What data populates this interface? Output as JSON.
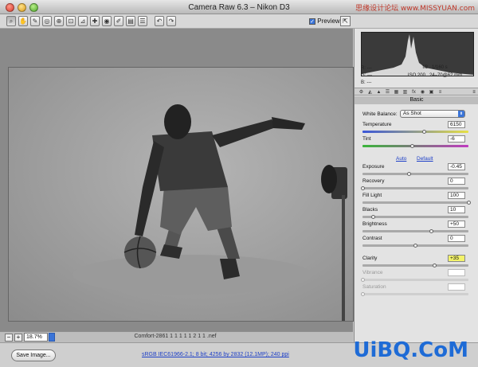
{
  "window": {
    "title": "Camera Raw 6.3  –  Nikon D3",
    "watermark_top": "思缘设计论坛  www.MISSYUAN.com"
  },
  "toolbar": {
    "tools": [
      "zoom-icon",
      "hand-icon",
      "white-balance-icon",
      "color-sampler-icon",
      "target-adjust-icon",
      "crop-icon",
      "straighten-icon",
      "spot-removal-icon",
      "red-eye-icon",
      "adjustment-brush-icon",
      "graduated-filter-icon",
      "preferences-icon",
      "rotate-ccw-icon",
      "rotate-cw-icon"
    ],
    "tool_glyphs": [
      "⌕",
      "✋",
      "✎",
      "◎",
      "⊕",
      "⊡",
      "⊿",
      "✚",
      "◉",
      "✐",
      "▤",
      "☰",
      "↶",
      "↷"
    ],
    "preview_label": "Preview",
    "preview_checked": true,
    "fullscreen_glyph": "⇱"
  },
  "histogram": {
    "r_label": "R:",
    "r_value": "---",
    "g_label": "G:",
    "g_value": "---",
    "b_label": "B:",
    "b_value": "---",
    "aperture": "f/8",
    "shutter": "1/160 s",
    "iso": "ISO 200",
    "lens": "24–70@62 mm"
  },
  "panel_tabs": [
    "⚙",
    "◭",
    "▲",
    "☰",
    "▦",
    "▥",
    "fx",
    "◉",
    "▣",
    "≡"
  ],
  "panel_menu_glyph": "≡",
  "basic": {
    "header": "Basic",
    "white_balance_label": "White Balance:",
    "white_balance_value": "As Shot",
    "temperature_label": "Temperature",
    "temperature_value": "6150",
    "temperature_pos": 0.58,
    "tint_label": "Tint",
    "tint_value": "-6",
    "tint_pos": 0.47,
    "auto_label": "Auto",
    "default_label": "Default",
    "exposure_label": "Exposure",
    "exposure_value": "-0.45",
    "exposure_pos": 0.44,
    "recovery_label": "Recovery",
    "recovery_value": "0",
    "recovery_pos": 0.0,
    "fill_light_label": "Fill Light",
    "fill_light_value": "100",
    "fill_light_pos": 1.0,
    "blacks_label": "Blacks",
    "blacks_value": "10",
    "blacks_pos": 0.1,
    "brightness_label": "Brightness",
    "brightness_value": "+50",
    "brightness_pos": 0.65,
    "contrast_label": "Contrast",
    "contrast_value": "0",
    "contrast_pos": 0.5,
    "clarity_label": "Clarity",
    "clarity_value": "+35",
    "clarity_pos": 0.68,
    "vibrance_label": "Vibrance",
    "vibrance_value": "",
    "vibrance_pos": 0.0,
    "saturation_label": "Saturation",
    "saturation_value": "",
    "saturation_pos": 0.0
  },
  "preview": {
    "zoom_value": "18.7%",
    "zoom_out_glyph": "−",
    "zoom_in_glyph": "+",
    "filename": "Comfort-2861 1 1 1 1 1 2 1 1 .nef"
  },
  "footer": {
    "save_label": "Save Image...",
    "workflow_text": "sRGB IEC61966-2.1; 8 bit; 4256 by 2832 (12.1MP); 240 ppi",
    "watermark_bottom": "UiBQ.CoM"
  },
  "colors": {
    "accent": "#3a74d8",
    "link": "#1d3fc7",
    "highlight": "#f3f36a"
  }
}
